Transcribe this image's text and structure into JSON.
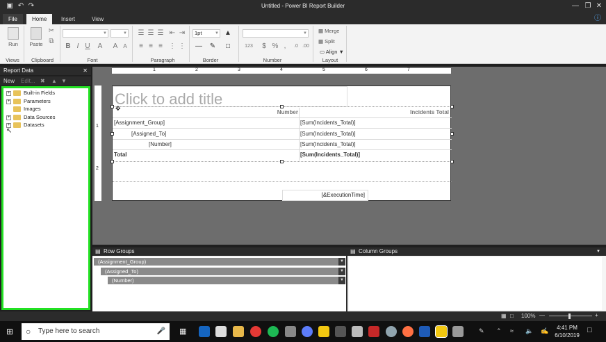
{
  "window": {
    "title": "Untitled - Power BI Report Builder"
  },
  "tabs": {
    "file": "File",
    "home": "Home",
    "insert": "Insert",
    "view": "View"
  },
  "ribbon": {
    "run": "Run",
    "paste": "Paste",
    "groups": {
      "views": "Views",
      "clipboard": "Clipboard",
      "font": "Font",
      "paragraph": "Paragraph",
      "border": "Border",
      "number": "Number",
      "layout": "Layout"
    },
    "border_width": "1pt",
    "merge": "Merge",
    "split": "Split",
    "align": "Align"
  },
  "report_data": {
    "title": "Report Data",
    "toolbar": {
      "new": "New",
      "edit": "Edit..."
    },
    "items": [
      "Built-in Fields",
      "Parameters",
      "Images",
      "Data Sources",
      "Datasets"
    ]
  },
  "canvas": {
    "title_placeholder": "Click to add title",
    "header": {
      "number": "Number",
      "incidents_total": "Incidents Total"
    },
    "rows": [
      {
        "label": "[Assignment_Group]",
        "value": "[Sum(Incidents_Total)]"
      },
      {
        "label": "[Assigned_To]",
        "value": "[Sum(Incidents_Total)]"
      },
      {
        "label": "[Number]",
        "value": "[Sum(Incidents_Total)]"
      }
    ],
    "total": {
      "label": "Total",
      "value": "[Sum(Incidents_Total)]"
    },
    "execution_time": "[&ExecutionTime]"
  },
  "ruler_marks": [
    "1",
    "2",
    "3",
    "4",
    "5",
    "6",
    "7"
  ],
  "groups": {
    "row_title": "Row Groups",
    "column_title": "Column Groups",
    "row_items": [
      "(Assignment_Group)",
      "(Assigned_To)",
      "(Number)"
    ]
  },
  "status": {
    "zoom": "100%"
  },
  "taskbar": {
    "search_placeholder": "Type here to search",
    "time": "4:41 PM",
    "date": "6/10/2019"
  }
}
